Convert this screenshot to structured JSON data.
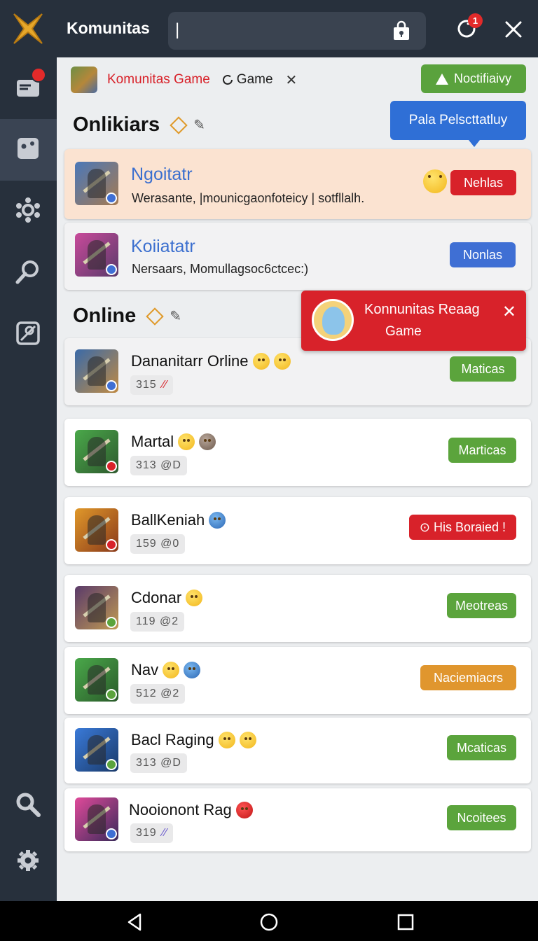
{
  "app": {
    "title": "Komunitas",
    "search_value": "|",
    "notification_count": "1"
  },
  "sidebar": {
    "items": [
      {
        "icon": "mail-icon",
        "has_badge": true
      },
      {
        "icon": "dice-icon",
        "active": true
      },
      {
        "icon": "gear-cluster-icon"
      },
      {
        "icon": "search-icon"
      },
      {
        "icon": "camera-icon"
      },
      {
        "icon": "search-icon"
      },
      {
        "icon": "settings-icon"
      }
    ]
  },
  "header": {
    "game_name": "Komunitas Game",
    "game_tag": "Game",
    "close_glyph": "✕",
    "notify_label": "Noctifiaivy",
    "tooltip": "Pala Pelscttatluy"
  },
  "sections": {
    "first_title": "Onlikiars",
    "second_title": "Online"
  },
  "featured": [
    {
      "name": "Ngoitatr",
      "desc": "Werasante, |mounicgaonfoteicy | sotfllalh.",
      "status": "Nehlas",
      "status_color": "#d8222a"
    },
    {
      "name": "Koiiatatr",
      "desc": "Nersaars,  Momullagsoc6ctcec:)",
      "status": "Nonlas",
      "status_color": "#3f6fd4"
    }
  ],
  "toast": {
    "title": "Konnunitas Reaag",
    "subtitle": "Game",
    "close_glyph": "✕"
  },
  "players": [
    {
      "name": "Dananitarr Orline",
      "count": "315",
      "status": "Maticas",
      "color": "green"
    },
    {
      "name": "Martal",
      "count": "313  @D",
      "status": "Marticas",
      "color": "green"
    },
    {
      "name": "BallKeniah",
      "count": "159  @0",
      "status": "⊙ His Boraied !",
      "color": "red"
    },
    {
      "name": "Cdonar",
      "count": "119  @2",
      "status": "Meotreas",
      "color": "green"
    },
    {
      "name": "Nav",
      "count": "512  @2",
      "status": "Naciemiacrs",
      "color": "orange"
    },
    {
      "name": "Bacl Raging",
      "count": "313  @D",
      "status": "Mcaticas",
      "color": "green"
    },
    {
      "name": "Nooionont Rag",
      "count": "319",
      "status": "Ncoitees",
      "color": "green"
    }
  ]
}
